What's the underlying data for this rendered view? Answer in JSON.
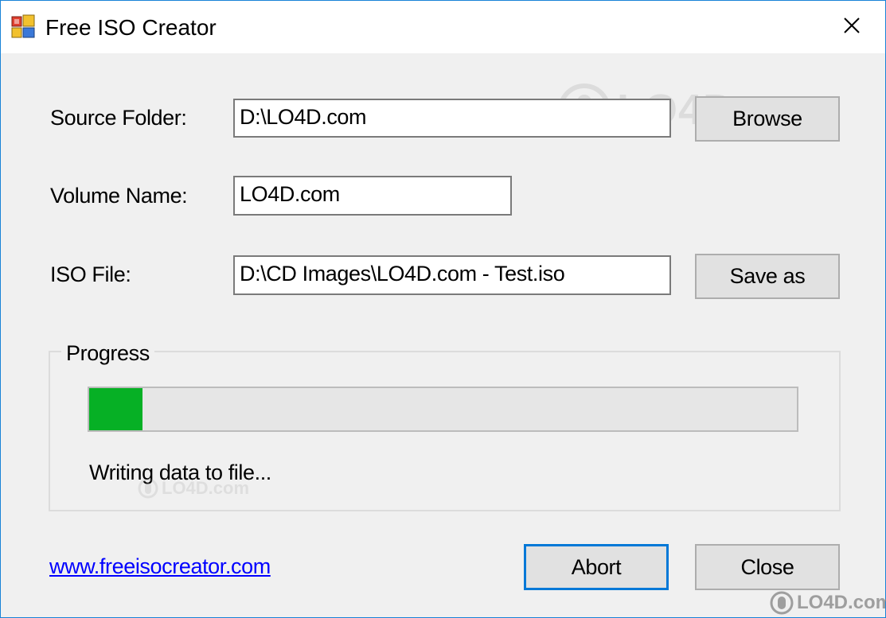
{
  "window": {
    "title": "Free ISO Creator"
  },
  "form": {
    "source_label": "Source Folder:",
    "source_value": "D:\\LO4D.com",
    "browse_label": "Browse",
    "volume_label": "Volume Name:",
    "volume_value": "LO4D.com",
    "iso_label": "ISO File:",
    "iso_value": "D:\\CD Images\\LO4D.com - Test.iso",
    "save_as_label": "Save as"
  },
  "progress": {
    "group_title": "Progress",
    "fraction": 0.075,
    "fill_color": "#06b025",
    "status_text": "Writing data to file..."
  },
  "footer": {
    "link_text": "www.freeisocreator.com",
    "abort_label": "Abort",
    "close_label": "Close"
  },
  "watermark": {
    "text": "LO4D.com",
    "corner_text": "LO4D.com"
  },
  "icons": {
    "app": "app-icon",
    "close": "close-icon"
  },
  "colors": {
    "accent": "#0078d7",
    "link": "#0000ff"
  }
}
